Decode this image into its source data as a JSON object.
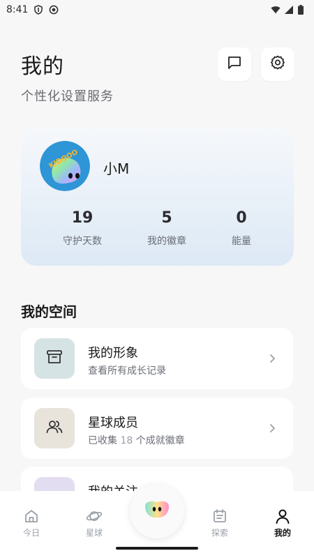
{
  "status_bar": {
    "time": "8:41"
  },
  "header": {
    "title": "我的",
    "subtitle": "个性化设置服务"
  },
  "profile": {
    "name": "小M",
    "avatar_text": "KIDOOO",
    "stats": [
      {
        "value": "19",
        "label": "守护天数"
      },
      {
        "value": "5",
        "label": "我的徽章"
      },
      {
        "value": "0",
        "label": "能量"
      }
    ]
  },
  "section": {
    "title": "我的空间"
  },
  "list": [
    {
      "title": "我的形象",
      "desc": "查看所有成长记录",
      "icon": "archive-icon",
      "icon_bg": "#d6e3e5"
    },
    {
      "title": "星球成员",
      "desc_prefix": "已收集",
      "desc_count": "18",
      "desc_suffix": "个成就徽章",
      "icon": "users-icon",
      "icon_bg": "#e8e4dc"
    },
    {
      "title": "我的关注",
      "icon": "up-icon",
      "icon_bg": "#e3ddf1"
    }
  ],
  "nav": [
    {
      "label": "今日",
      "icon": "home-icon"
    },
    {
      "label": "星球",
      "icon": "planet-icon"
    },
    {
      "label": "探索",
      "icon": "calendar-icon"
    },
    {
      "label": "我的",
      "icon": "profile-icon",
      "active": true
    }
  ]
}
